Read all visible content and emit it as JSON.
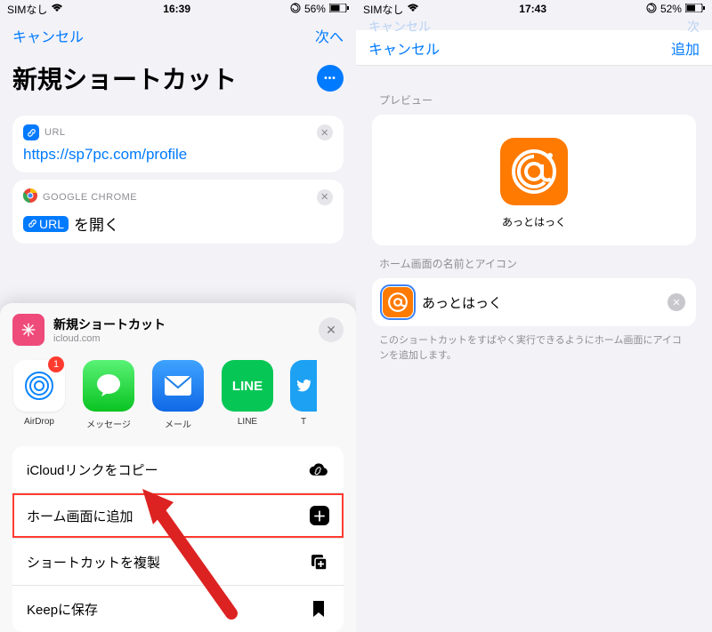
{
  "left": {
    "status": {
      "sim": "SIMなし",
      "time": "16:39",
      "battery": "56%"
    },
    "nav": {
      "cancel": "キャンセル",
      "next": "次へ"
    },
    "title": "新規ショートカット",
    "urlCard": {
      "label": "URL",
      "value": "https://sp7pc.com/profile"
    },
    "chromeCard": {
      "label": "GOOGLE CHROME",
      "badge": "URL",
      "action": "を開く"
    },
    "share": {
      "title": "新規ショートカット",
      "sub": "icloud.com",
      "apps": [
        {
          "name": "AirDrop",
          "badge": "1"
        },
        {
          "name": "メッセージ"
        },
        {
          "name": "メール"
        },
        {
          "name": "LINE"
        },
        {
          "name": "T"
        }
      ],
      "actions": {
        "copy": "iCloudリンクをコピー",
        "add": "ホーム画面に追加",
        "dup": "ショートカットを複製",
        "keep": "Keepに保存"
      }
    }
  },
  "right": {
    "status": {
      "sim": "SIMなし",
      "time": "17:43",
      "battery": "52%"
    },
    "nav": {
      "cancel": "キャンセル",
      "add": "追加"
    },
    "previewLabel": "プレビュー",
    "previewName": "あっとはっく",
    "nameLabel": "ホーム画面の名前とアイコン",
    "nameValue": "あっとはっく",
    "help": "このショートカットをすばやく実行できるようにホーム画面にアイコンを追加します。"
  }
}
